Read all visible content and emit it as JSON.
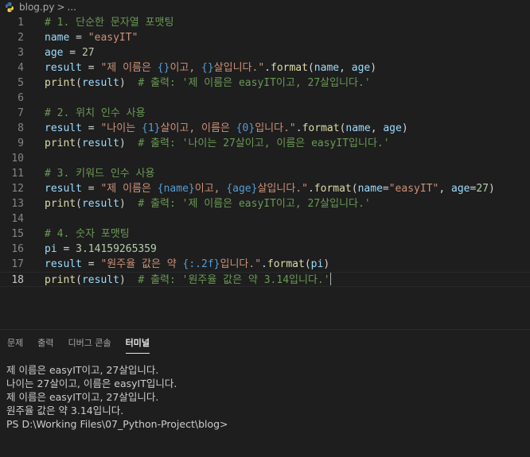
{
  "breadcrumb": {
    "file": "blog.py",
    "separator": ">",
    "more": "..."
  },
  "editor": {
    "lines": [
      {
        "n": "1",
        "tokens": [
          {
            "t": "# 1. 단순한 문자열 포맷팅",
            "c": "cm"
          }
        ]
      },
      {
        "n": "2",
        "tokens": [
          {
            "t": "name",
            "c": "var"
          },
          {
            "t": " = ",
            "c": "op"
          },
          {
            "t": "\"easyIT\"",
            "c": "str"
          }
        ]
      },
      {
        "n": "3",
        "tokens": [
          {
            "t": "age",
            "c": "var"
          },
          {
            "t": " = ",
            "c": "op"
          },
          {
            "t": "27",
            "c": "num"
          }
        ]
      },
      {
        "n": "4",
        "tokens": [
          {
            "t": "result",
            "c": "var"
          },
          {
            "t": " = ",
            "c": "op"
          },
          {
            "t": "\"제 이름은 ",
            "c": "str"
          },
          {
            "t": "{}",
            "c": "fmt"
          },
          {
            "t": "이고, ",
            "c": "str"
          },
          {
            "t": "{}",
            "c": "fmt"
          },
          {
            "t": "살입니다.\"",
            "c": "str"
          },
          {
            "t": ".",
            "c": "op"
          },
          {
            "t": "format",
            "c": "fn"
          },
          {
            "t": "(",
            "c": "op"
          },
          {
            "t": "name",
            "c": "var"
          },
          {
            "t": ", ",
            "c": "op"
          },
          {
            "t": "age",
            "c": "var"
          },
          {
            "t": ")",
            "c": "op"
          }
        ]
      },
      {
        "n": "5",
        "tokens": [
          {
            "t": "print",
            "c": "fn"
          },
          {
            "t": "(",
            "c": "op"
          },
          {
            "t": "result",
            "c": "var"
          },
          {
            "t": ")  ",
            "c": "op"
          },
          {
            "t": "# 출력: '제 이름은 easyIT이고, 27살입니다.'",
            "c": "cm"
          }
        ]
      },
      {
        "n": "6",
        "tokens": []
      },
      {
        "n": "7",
        "tokens": [
          {
            "t": "# 2. 위치 인수 사용",
            "c": "cm"
          }
        ]
      },
      {
        "n": "8",
        "tokens": [
          {
            "t": "result",
            "c": "var"
          },
          {
            "t": " = ",
            "c": "op"
          },
          {
            "t": "\"나이는 ",
            "c": "str"
          },
          {
            "t": "{1}",
            "c": "fmt"
          },
          {
            "t": "살이고, 이름은 ",
            "c": "str"
          },
          {
            "t": "{0}",
            "c": "fmt"
          },
          {
            "t": "입니다.\"",
            "c": "str"
          },
          {
            "t": ".",
            "c": "op"
          },
          {
            "t": "format",
            "c": "fn"
          },
          {
            "t": "(",
            "c": "op"
          },
          {
            "t": "name",
            "c": "var"
          },
          {
            "t": ", ",
            "c": "op"
          },
          {
            "t": "age",
            "c": "var"
          },
          {
            "t": ")",
            "c": "op"
          }
        ]
      },
      {
        "n": "9",
        "tokens": [
          {
            "t": "print",
            "c": "fn"
          },
          {
            "t": "(",
            "c": "op"
          },
          {
            "t": "result",
            "c": "var"
          },
          {
            "t": ")  ",
            "c": "op"
          },
          {
            "t": "# 출력: '나이는 27살이고, 이름은 easyIT입니다.'",
            "c": "cm"
          }
        ]
      },
      {
        "n": "10",
        "tokens": []
      },
      {
        "n": "11",
        "tokens": [
          {
            "t": "# 3. 키워드 인수 사용",
            "c": "cm"
          }
        ]
      },
      {
        "n": "12",
        "tokens": [
          {
            "t": "result",
            "c": "var"
          },
          {
            "t": " = ",
            "c": "op"
          },
          {
            "t": "\"제 이름은 ",
            "c": "str"
          },
          {
            "t": "{name}",
            "c": "fmt"
          },
          {
            "t": "이고, ",
            "c": "str"
          },
          {
            "t": "{age}",
            "c": "fmt"
          },
          {
            "t": "살입니다.\"",
            "c": "str"
          },
          {
            "t": ".",
            "c": "op"
          },
          {
            "t": "format",
            "c": "fn"
          },
          {
            "t": "(",
            "c": "op"
          },
          {
            "t": "name",
            "c": "var"
          },
          {
            "t": "=",
            "c": "op"
          },
          {
            "t": "\"easyIT\"",
            "c": "str"
          },
          {
            "t": ", ",
            "c": "op"
          },
          {
            "t": "age",
            "c": "var"
          },
          {
            "t": "=",
            "c": "op"
          },
          {
            "t": "27",
            "c": "num"
          },
          {
            "t": ")",
            "c": "op"
          }
        ]
      },
      {
        "n": "13",
        "tokens": [
          {
            "t": "print",
            "c": "fn"
          },
          {
            "t": "(",
            "c": "op"
          },
          {
            "t": "result",
            "c": "var"
          },
          {
            "t": ")  ",
            "c": "op"
          },
          {
            "t": "# 출력: '제 이름은 easyIT이고, 27살입니다.'",
            "c": "cm"
          }
        ]
      },
      {
        "n": "14",
        "tokens": []
      },
      {
        "n": "15",
        "tokens": [
          {
            "t": "# 4. 숫자 포맷팅",
            "c": "cm"
          }
        ]
      },
      {
        "n": "16",
        "tokens": [
          {
            "t": "pi",
            "c": "var"
          },
          {
            "t": " = ",
            "c": "op"
          },
          {
            "t": "3.14159265359",
            "c": "num"
          }
        ]
      },
      {
        "n": "17",
        "tokens": [
          {
            "t": "result",
            "c": "var"
          },
          {
            "t": " = ",
            "c": "op"
          },
          {
            "t": "\"원주율 값은 약 ",
            "c": "str"
          },
          {
            "t": "{:.2f}",
            "c": "fmt"
          },
          {
            "t": "입니다.\"",
            "c": "str"
          },
          {
            "t": ".",
            "c": "op"
          },
          {
            "t": "format",
            "c": "fn"
          },
          {
            "t": "(",
            "c": "op"
          },
          {
            "t": "pi",
            "c": "var"
          },
          {
            "t": ")",
            "c": "op"
          }
        ]
      },
      {
        "n": "18",
        "tokens": [
          {
            "t": "print",
            "c": "fn"
          },
          {
            "t": "(",
            "c": "op"
          },
          {
            "t": "result",
            "c": "var"
          },
          {
            "t": ")  ",
            "c": "op"
          },
          {
            "t": "# 출력: '원주율 값은 약 3.14입니다.'",
            "c": "cm"
          }
        ]
      }
    ]
  },
  "panel": {
    "tabs": [
      {
        "label": "문제",
        "active": false
      },
      {
        "label": "출력",
        "active": false
      },
      {
        "label": "디버그 콘솔",
        "active": false
      },
      {
        "label": "터미널",
        "active": true
      }
    ]
  },
  "terminal": {
    "lines": [
      "제 이름은 easyIT이고, 27살입니다.",
      "나이는 27살이고, 이름은 easyIT입니다.",
      "제 이름은 easyIT이고, 27살입니다.",
      "원주율 값은 약 3.14입니다.",
      "PS D:\\Working Files\\07_Python-Project\\blog>"
    ]
  },
  "colors": {
    "background": "#1e1e1e",
    "comment": "#6a9955",
    "variable": "#9cdcfe",
    "string": "#ce9178",
    "function": "#dcdcaa",
    "number": "#b5cea8",
    "format_placeholder": "#569cd6"
  },
  "icons": {
    "file": "python-file-icon"
  }
}
